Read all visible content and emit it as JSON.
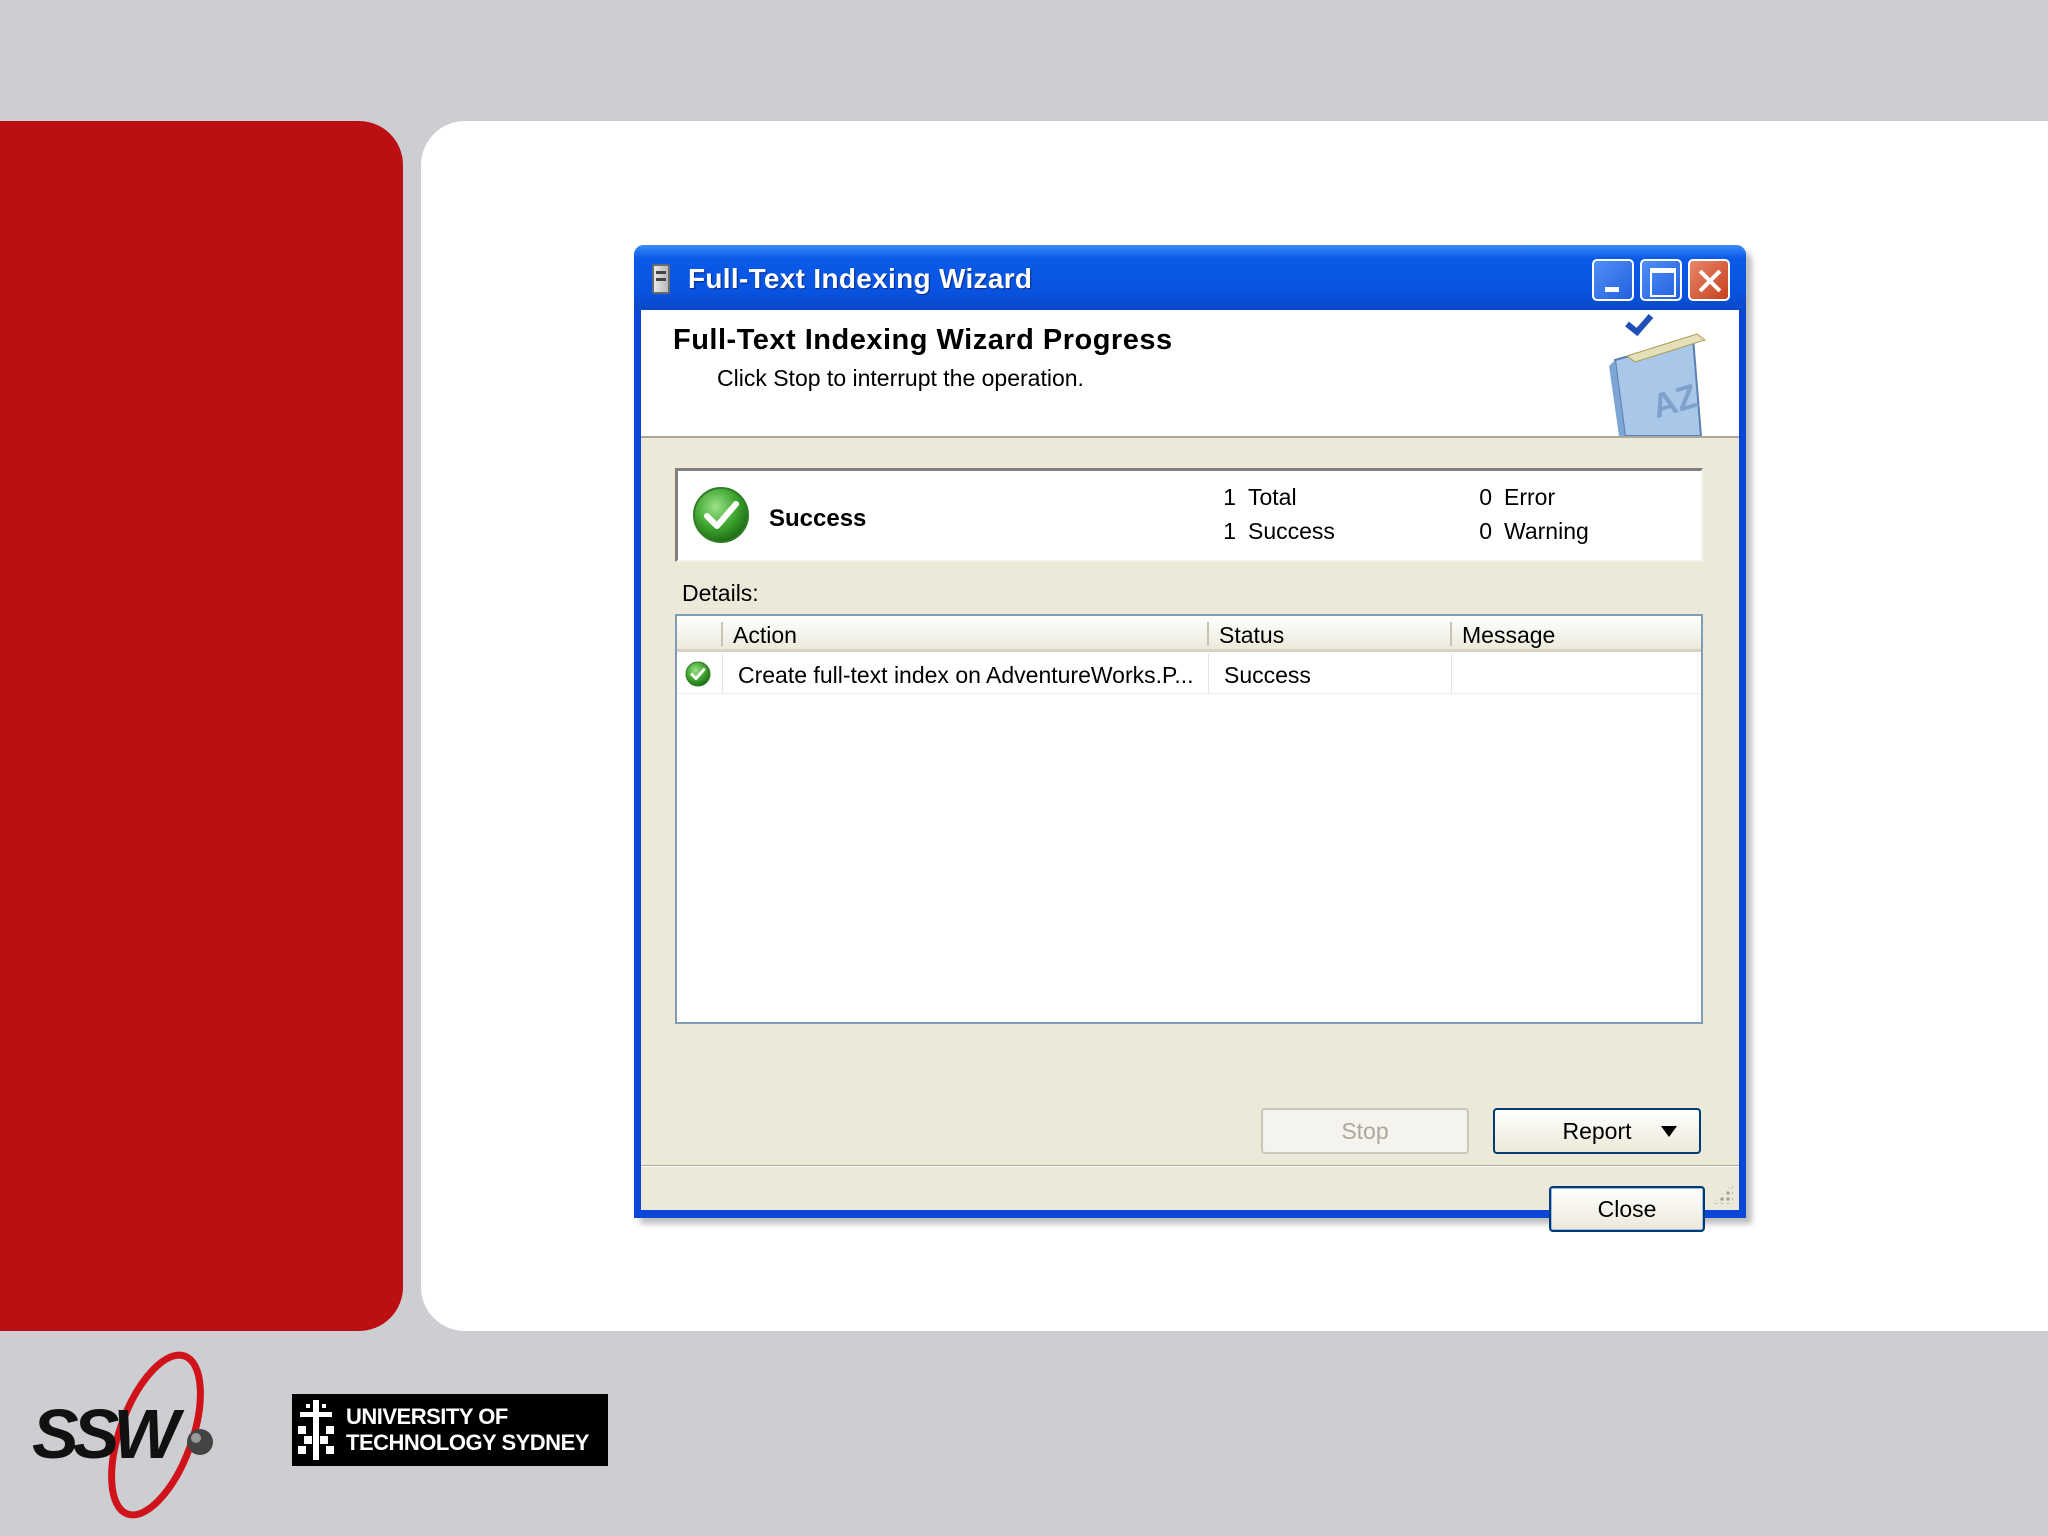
{
  "window": {
    "title": "Full-Text Indexing Wizard"
  },
  "header": {
    "title": "Full-Text Indexing Wizard Progress",
    "subtitle": "Click Stop to interrupt the operation."
  },
  "summary": {
    "status": "Success",
    "total_count": "1",
    "total_label": "Total",
    "success_count": "1",
    "success_label": "Success",
    "error_count": "0",
    "error_label": "Error",
    "warning_count": "0",
    "warning_label": "Warning"
  },
  "details": {
    "label": "Details:",
    "columns": [
      "Action",
      "Status",
      "Message"
    ],
    "rows": [
      {
        "action": "Create full-text index on AdventureWorks.P...",
        "status": "Success",
        "message": ""
      }
    ]
  },
  "buttons": {
    "stop": "Stop",
    "report": "Report",
    "close": "Close"
  },
  "logos": {
    "ssw": "SSW",
    "uts_line1": "UNIVERSITY OF",
    "uts_line2": "TECHNOLOGY SYDNEY"
  },
  "colors": {
    "brand_red": "#bb0f13",
    "xp_blue": "#0a46d8",
    "dialog_bg": "#ece9d8",
    "success_green": "#3a9a2a"
  }
}
